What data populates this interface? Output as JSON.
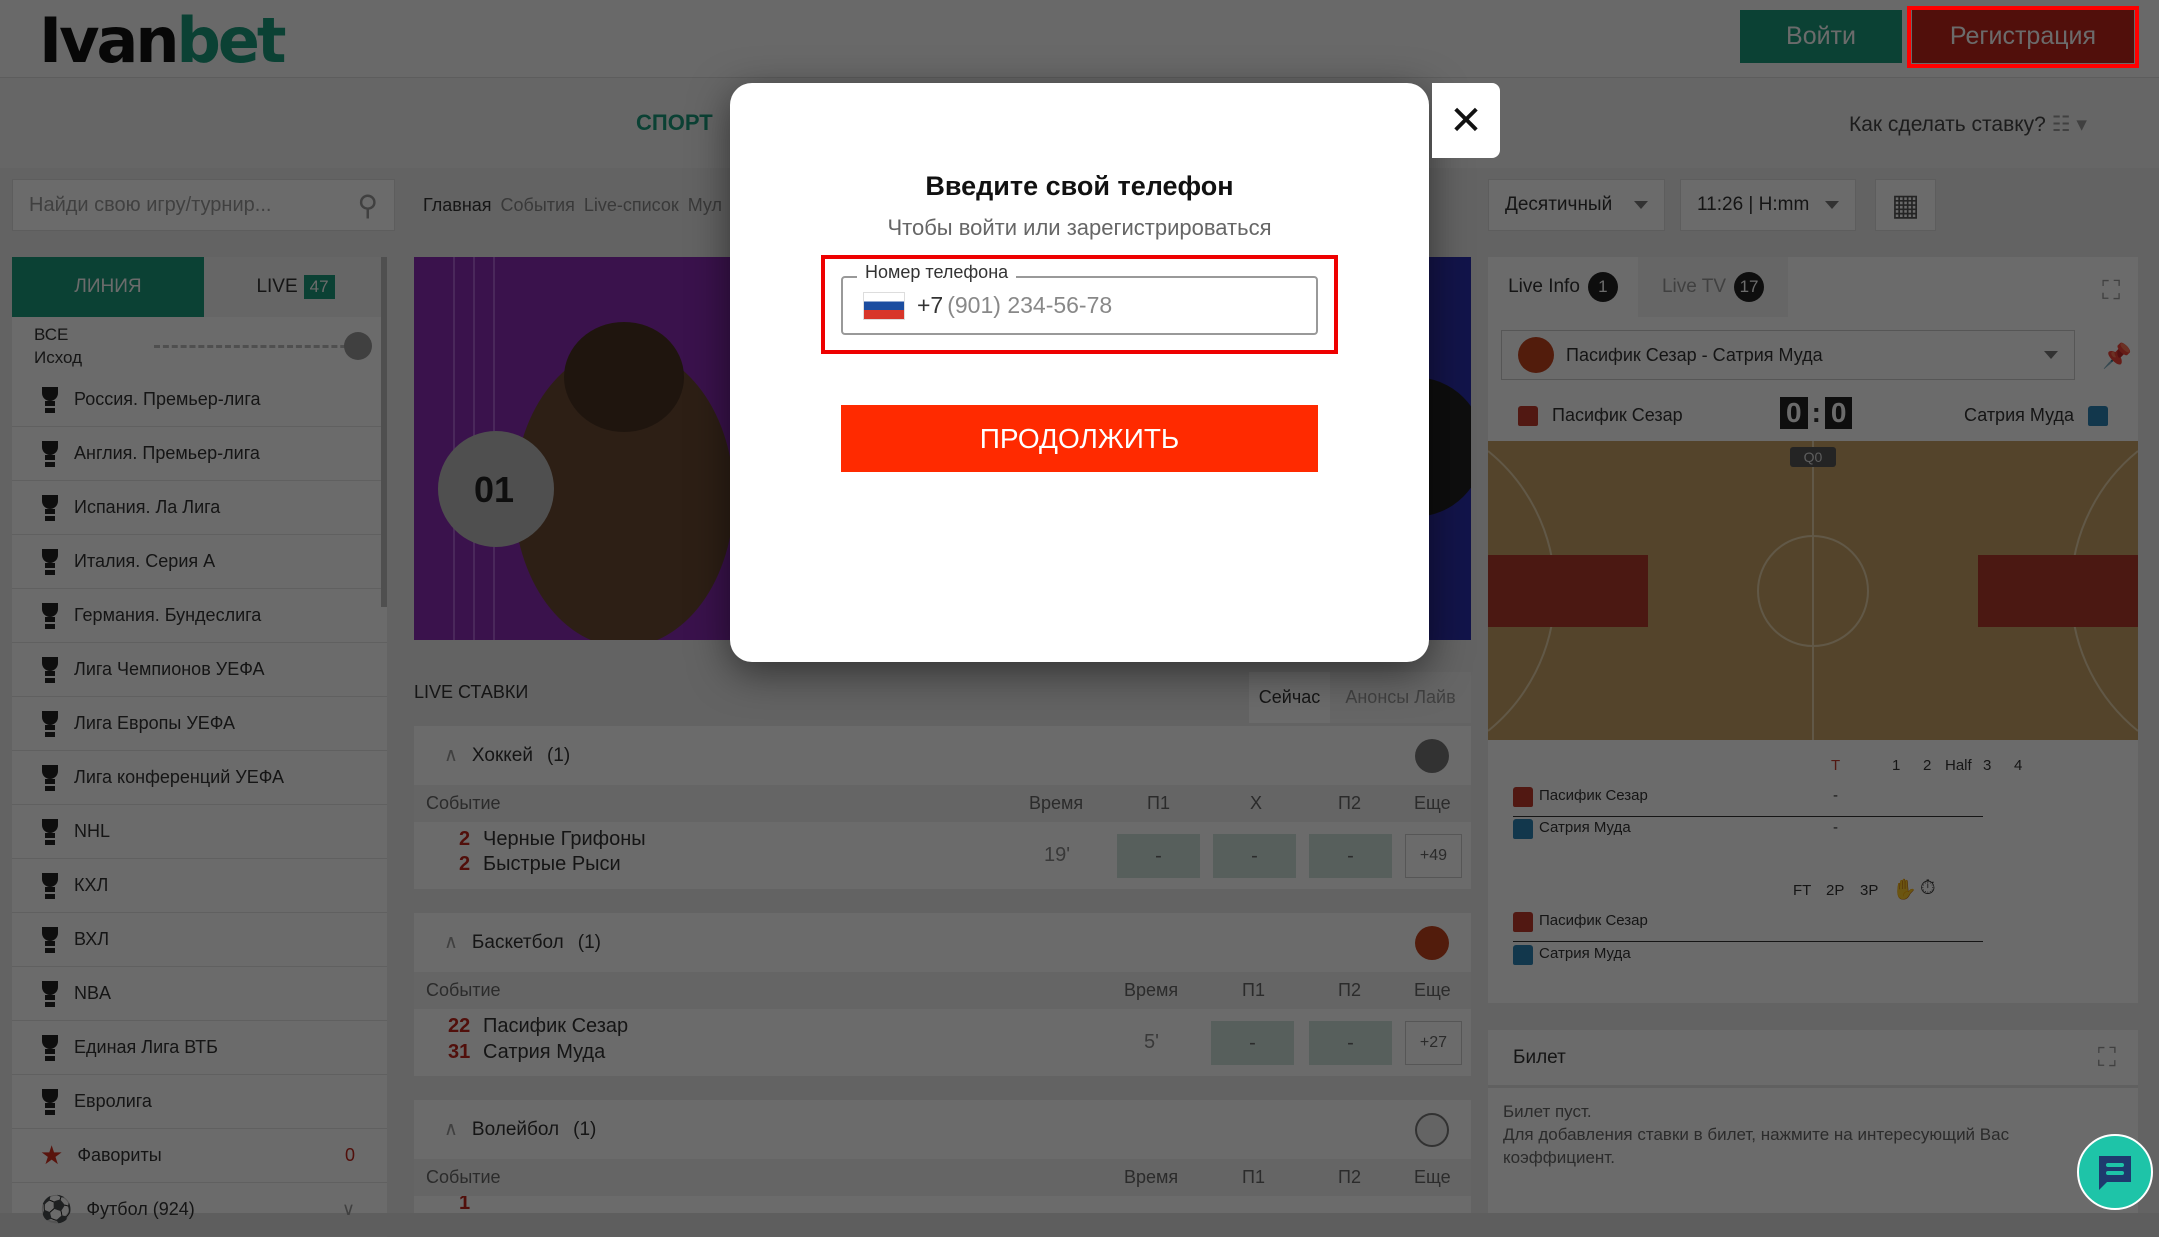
{
  "header": {
    "logo": "Ivanbet",
    "login": "Войти",
    "register": "Регистрация"
  },
  "nav": {
    "sport": "СПОРТ",
    "how_to_bet": "Как сделать ставку?"
  },
  "search": {
    "placeholder": "Найди свою игру/турнир..."
  },
  "breadcrumbs": [
    "Главная",
    "События",
    "Live-список",
    "Мул"
  ],
  "settings": {
    "odds_format": "Десятичный",
    "time_format": "11:26 | H:mm"
  },
  "sidebar": {
    "tab_line": "ЛИНИЯ",
    "tab_live": "LIVE",
    "live_count": "47",
    "filter_all": "ВСЕ",
    "filter_outcome": "Исход",
    "items": [
      "Россия. Премьер-лига",
      "Англия. Премьер-лига",
      "Испания. Ла Лига",
      "Италия. Серия А",
      "Германия. Бундеслига",
      "Лига Чемпионов УЕФА",
      "Лига Европы УЕФА",
      "Лига конференций УЕФА",
      "NHL",
      "КХЛ",
      "ВХЛ",
      "NBA",
      "Единая Лига ВТБ",
      "Евролига"
    ],
    "favorites": "Фавориты",
    "favorites_count": "0",
    "football": "Футбол (924)"
  },
  "live": {
    "title": "LIVE СТАВКИ",
    "tab_now": "Сейчас",
    "tab_announce": "Анонсы Лайв",
    "cols": {
      "event": "Событие",
      "time": "Время",
      "p1": "П1",
      "x": "X",
      "p2": "П2",
      "more": "Еще"
    },
    "sections": [
      {
        "name": "Хоккей",
        "count": "(1)",
        "team1": "Черные Грифоны",
        "score1": "2",
        "team2": "Быстрые Рыси",
        "score2": "2",
        "time": "19'",
        "p1": "-",
        "x": "-",
        "p2": "-",
        "more": "+49"
      },
      {
        "name": "Баскетбол",
        "count": "(1)",
        "team1": "Пасифик Сезар",
        "score1": "22",
        "team2": "Сатрия Муда",
        "score2": "31",
        "time": "5'",
        "p1": "-",
        "p2": "-",
        "more": "+27"
      },
      {
        "name": "Волейбол",
        "count": "(1)",
        "score1": "1"
      }
    ]
  },
  "right": {
    "tab_info": "Live Info",
    "info_count": "1",
    "tab_tv": "Live TV",
    "tv_count": "17",
    "match": "Пасифик Сезар - Сатрия Муда",
    "home": "Пасифик Сезар",
    "away": "Сатрия Муда",
    "home_score": "0",
    "away_score": "0",
    "period": "Q0",
    "periods": [
      "T",
      "1",
      "2",
      "Half",
      "3",
      "4"
    ],
    "home_total": "-",
    "away_total": "-",
    "stats": [
      "FT",
      "2P",
      "3P"
    ]
  },
  "ticket": {
    "title": "Билет",
    "empty": "Билет пуст.",
    "hint": "Для добавления ставки в билет, нажмите на интересующий Вас коэффициент."
  },
  "modal": {
    "title": "Введите свой телефон",
    "subtitle": "Чтобы войти или зарегистрироваться",
    "field_label": "Номер телефона",
    "prefix": "+7",
    "placeholder": "(901) 234-56-78",
    "continue": "ПРОДОЛЖИТЬ"
  },
  "colors": {
    "brand": "#1a9a7b",
    "register": "#c0241a",
    "continue": "#ff2a00",
    "highlight": "#ff0000"
  }
}
